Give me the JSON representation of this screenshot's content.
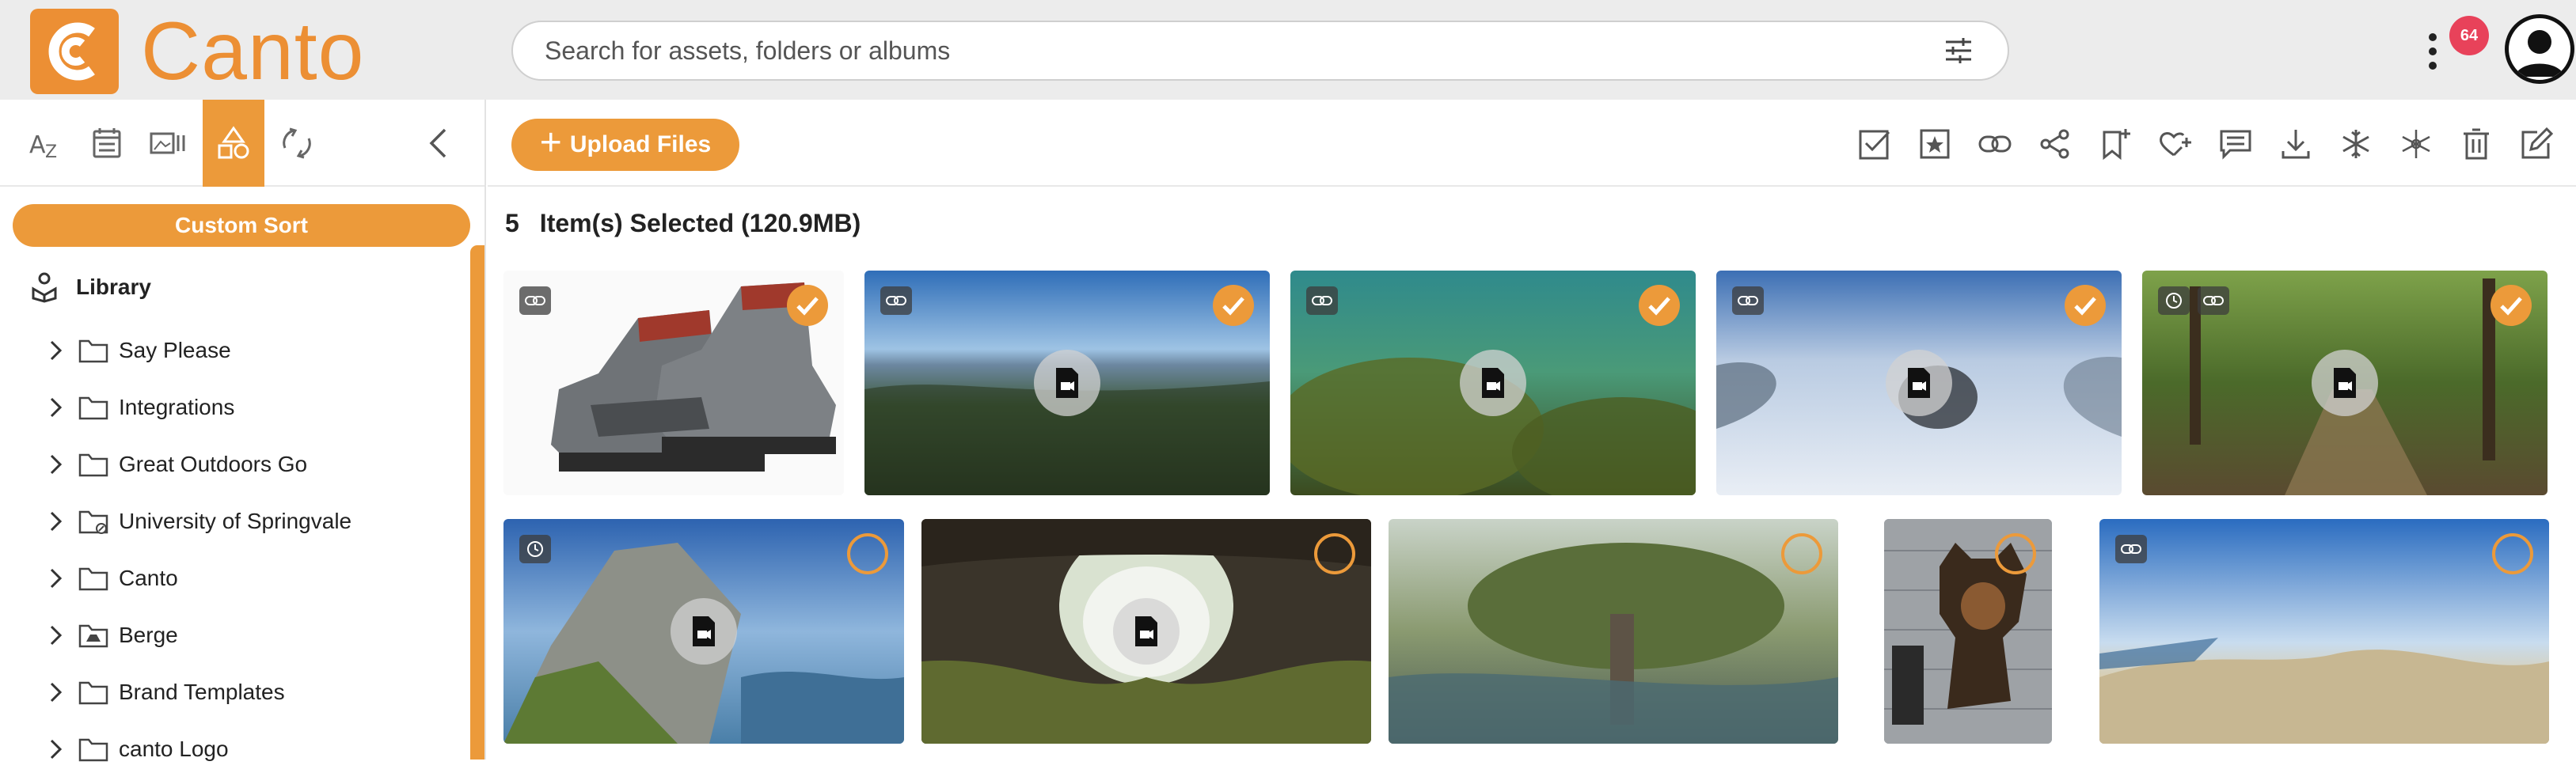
{
  "app": {
    "logo_text": "Canto",
    "brand_color": "#ec9a3a"
  },
  "header": {
    "search_placeholder": "Search for assets, folders or albums",
    "notification_count": "64",
    "icons": [
      "filter-sliders-icon",
      "kebab-menu-icon",
      "user-avatar-icon"
    ]
  },
  "sidebar": {
    "tools": [
      "sort-az-icon",
      "calendar-icon",
      "gallery-icon",
      "shapes-icon",
      "refresh-icon"
    ],
    "active_tool": "shapes-icon",
    "custom_sort_label": "Custom Sort",
    "library_label": "Library",
    "items": [
      {
        "label": "Say Please",
        "icon": "folder-icon"
      },
      {
        "label": "Integrations",
        "icon": "folder-icon"
      },
      {
        "label": "Great Outdoors Go",
        "icon": "folder-icon"
      },
      {
        "label": "University of Springvale",
        "icon": "folder-shared-icon"
      },
      {
        "label": "Canto",
        "icon": "folder-icon"
      },
      {
        "label": "Berge",
        "icon": "folder-drive-icon"
      },
      {
        "label": "Brand Templates",
        "icon": "folder-icon"
      },
      {
        "label": "canto Logo",
        "icon": "folder-icon"
      }
    ]
  },
  "toolbar": {
    "upload_label": "Upload Files",
    "actions": [
      "select-all-icon",
      "star-icon",
      "link-icon",
      "share-icon",
      "bookmark-add-icon",
      "favorite-add-icon",
      "comment-icon",
      "download-icon",
      "snowflake-icon",
      "snowflake-alt-icon",
      "trash-icon",
      "edit-icon"
    ]
  },
  "selection": {
    "count": "5",
    "text": "Item(s) Selected (120.9MB)"
  },
  "assets": [
    {
      "name": "hiking boots",
      "selected": true,
      "video": false,
      "overlays": [
        "link-icon"
      ]
    },
    {
      "name": "mountain valley panorama",
      "selected": true,
      "video": true,
      "overlays": [
        "link-icon"
      ]
    },
    {
      "name": "underwater reef",
      "selected": true,
      "video": true,
      "overlays": [
        "link-icon"
      ]
    },
    {
      "name": "snow slope",
      "selected": true,
      "video": true,
      "overlays": [
        "link-icon"
      ]
    },
    {
      "name": "forest path",
      "selected": true,
      "video": true,
      "overlays": [
        "clock-icon",
        "link-icon"
      ]
    },
    {
      "name": "mountain cliff lake",
      "selected": false,
      "video": true,
      "overlays": [
        "clock-icon"
      ]
    },
    {
      "name": "cave opening",
      "selected": false,
      "video": true,
      "overlays": []
    },
    {
      "name": "tree by pond",
      "selected": false,
      "video": false,
      "overlays": []
    },
    {
      "name": "dog on porch",
      "selected": false,
      "video": false,
      "overlays": []
    },
    {
      "name": "coastal hilltop sky",
      "selected": false,
      "video": false,
      "overlays": [
        "link-icon"
      ]
    }
  ]
}
